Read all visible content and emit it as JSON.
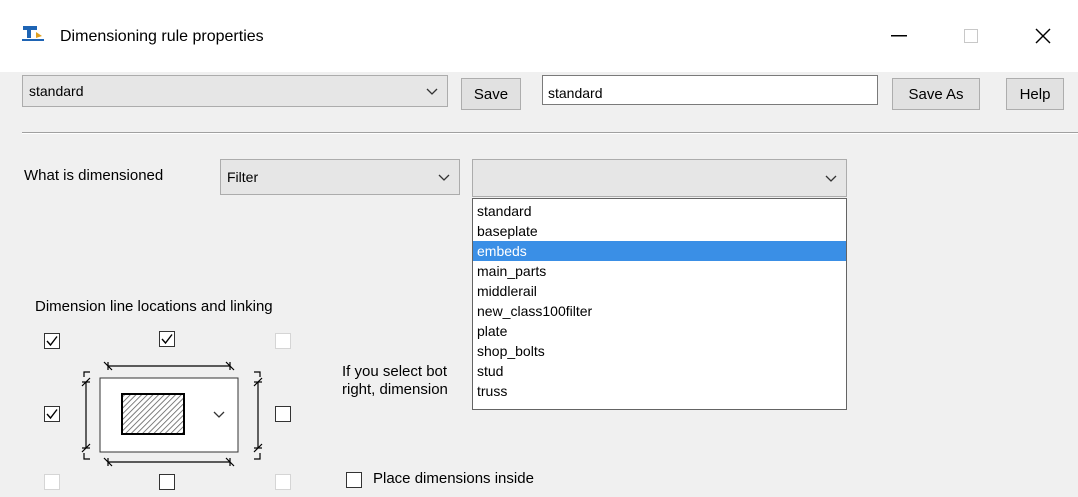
{
  "window": {
    "title": "Dimensioning rule properties",
    "minimize_glyph": "—",
    "close_glyph": "✕",
    "icon": "dimension-app-icon"
  },
  "toolbar": {
    "rule_select_value": "standard",
    "save_label": "Save",
    "name_field_value": "standard",
    "save_as_label": "Save As",
    "help_label": "Help"
  },
  "what_dimensioned": {
    "label": "What is dimensioned",
    "type_value": "Filter",
    "filter_value": "",
    "options": [
      "standard",
      "baseplate",
      "embeds",
      "main_parts",
      "middlerail",
      "new_class100filter",
      "plate",
      "shop_bolts",
      "stud",
      "truss"
    ],
    "highlighted": "embeds"
  },
  "dimension_lines": {
    "heading": "Dimension line locations and linking",
    "top_left_checked": true,
    "top_center_checked": true,
    "top_right_enabled": false,
    "middle_left_checked": true,
    "middle_right_checked": false,
    "bottom_left_enabled": false,
    "bottom_center_checked": false,
    "bottom_right_enabled": false
  },
  "info_text": {
    "line1": "If you select bot",
    "line2": "right, dimension"
  },
  "place_inside": {
    "label": "Place dimensions inside",
    "checked": false
  },
  "colors": {
    "highlight": "#3a8fe6",
    "dialog_bg": "#f0f0f0"
  }
}
